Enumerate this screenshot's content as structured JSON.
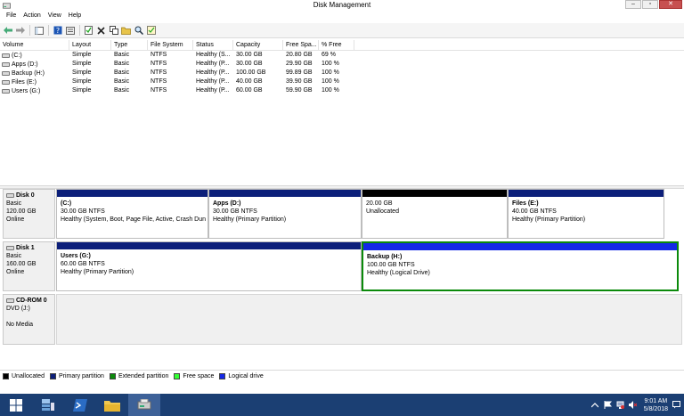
{
  "window": {
    "title": "Disk Management"
  },
  "menu": [
    "File",
    "Action",
    "View",
    "Help"
  ],
  "volume_table": {
    "columns": [
      "Volume",
      "Layout",
      "Type",
      "File System",
      "Status",
      "Capacity",
      "Free Spa...",
      "% Free"
    ],
    "rows": [
      [
        "(C:)",
        "Simple",
        "Basic",
        "NTFS",
        "Healthy (S...",
        "30.00 GB",
        "20.80 GB",
        "69 %"
      ],
      [
        "Apps (D:)",
        "Simple",
        "Basic",
        "NTFS",
        "Healthy (P...",
        "30.00 GB",
        "29.90 GB",
        "100 %"
      ],
      [
        "Backup (H:)",
        "Simple",
        "Basic",
        "NTFS",
        "Healthy (P...",
        "100.00 GB",
        "99.89 GB",
        "100 %"
      ],
      [
        "Files (E:)",
        "Simple",
        "Basic",
        "NTFS",
        "Healthy (P...",
        "40.00 GB",
        "39.90 GB",
        "100 %"
      ],
      [
        "Users (G:)",
        "Simple",
        "Basic",
        "NTFS",
        "Healthy (P...",
        "60.00 GB",
        "59.90 GB",
        "100 %"
      ]
    ]
  },
  "disks": [
    {
      "name": "Disk 0",
      "type": "Basic",
      "size": "120.00 GB",
      "state": "Online",
      "partitions": [
        {
          "name": "(C:)",
          "size": "30.00 GB NTFS",
          "status": "Healthy (System, Boot, Page File, Active, Crash Dun"
        },
        {
          "name": "Apps  (D:)",
          "size": "30.00 GB NTFS",
          "status": "Healthy (Primary Partition)"
        },
        {
          "name": "",
          "size": "20.00 GB",
          "status": "Unallocated"
        },
        {
          "name": "Files  (E:)",
          "size": "40.00 GB NTFS",
          "status": "Healthy (Primary Partition)"
        }
      ]
    },
    {
      "name": "Disk 1",
      "type": "Basic",
      "size": "160.00 GB",
      "state": "Online",
      "partitions": [
        {
          "name": "Users  (G:)",
          "size": "60.00 GB NTFS",
          "status": "Healthy (Primary Partition)"
        },
        {
          "name": "Backup  (H:)",
          "size": "100.00 GB NTFS",
          "status": "Healthy (Logical Drive)"
        }
      ]
    },
    {
      "name": "CD-ROM 0",
      "type": "DVD (J:)",
      "state": "No Media"
    }
  ],
  "legend": [
    {
      "label": "Unallocated",
      "color": "#000000"
    },
    {
      "label": "Primary partition",
      "color": "#0c1f7a"
    },
    {
      "label": "Extended partition",
      "color": "#0b8a0b"
    },
    {
      "label": "Free space",
      "color": "#33ff33"
    },
    {
      "label": "Logical drive",
      "color": "#1428e6"
    }
  ],
  "taskbar": {
    "time": "9:01 AM",
    "date": "5/8/2018"
  }
}
